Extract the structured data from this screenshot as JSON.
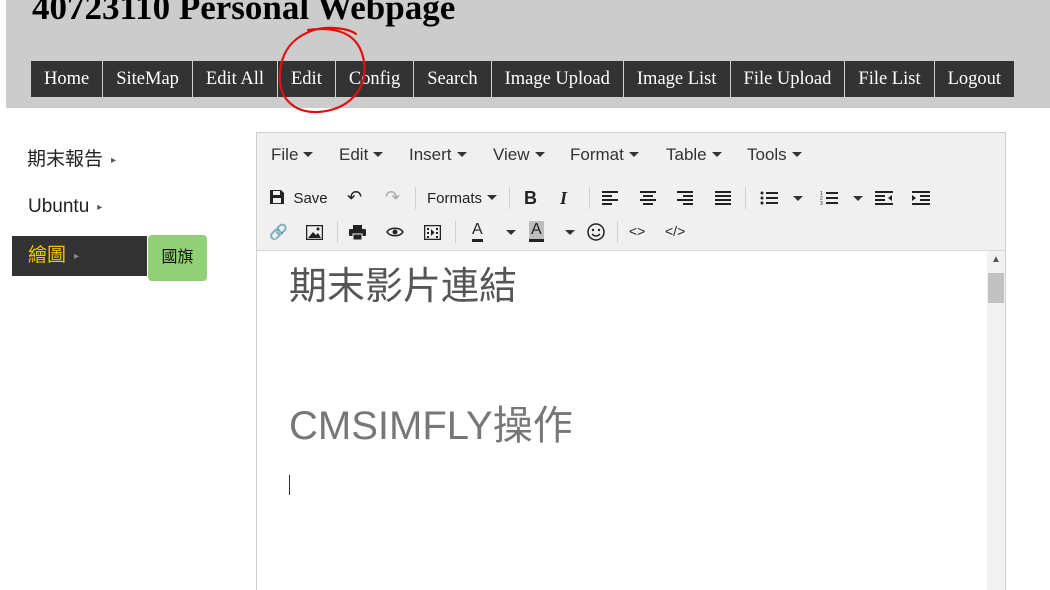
{
  "header": {
    "title": "40723110 Personal Webpage",
    "nav": [
      "Home",
      "SiteMap",
      "Edit All",
      "Edit",
      "Config",
      "Search",
      "Image Upload",
      "Image List",
      "File Upload",
      "File List",
      "Logout"
    ]
  },
  "sidebar": {
    "items": [
      {
        "label": "期末報告",
        "arrow": "▸"
      },
      {
        "label": "Ubuntu",
        "arrow": "▸"
      },
      {
        "label": "繪圖",
        "arrow": "▸"
      }
    ],
    "badge": "國旗"
  },
  "editor": {
    "menus": [
      "File",
      "Edit",
      "Insert",
      "View",
      "Format",
      "Table",
      "Tools"
    ],
    "toolbar": {
      "save_label": "Save",
      "formats_label": "Formats",
      "bold": "B",
      "italic": "I",
      "font_color": "A",
      "bg_color": "A",
      "code": "<>",
      "source": "</>"
    },
    "content": {
      "heading1": "期末影片連結",
      "heading2": "CMSIMFLY操作"
    }
  },
  "colors": {
    "header_bg": "#cccccc",
    "nav_bg": "#333333",
    "active_text": "#f6c300",
    "badge_bg": "#90d076",
    "annotation": "#e01010"
  }
}
